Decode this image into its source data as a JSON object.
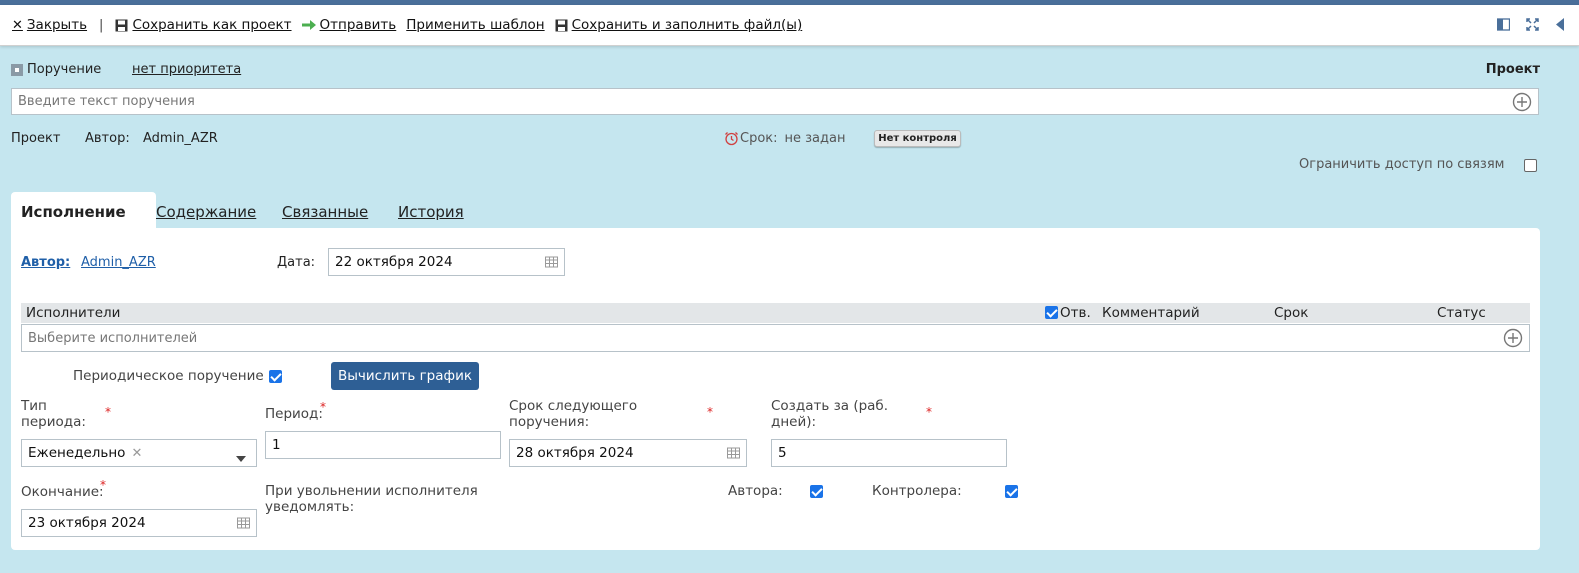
{
  "toolbar": {
    "close_label": "Закрыть",
    "separator": "|",
    "save_project_label": "Сохранить как проект",
    "send_label": "Отправить",
    "apply_template_label": "Применить шаблон",
    "save_fill_label": "Сохранить и заполнить файл(ы)"
  },
  "header": {
    "doc_type": "Поручение",
    "priority": "нет приоритета",
    "status": "Проект",
    "text_placeholder": "Введите текст поручения",
    "stage": "Проект",
    "author_label": "Автор:",
    "author_value": "Admin_AZR",
    "deadline_label": "Срок:",
    "deadline_value": "не задан",
    "control_badge": "Нет контроля",
    "restrict_access_label": "Ограничить доступ по связям",
    "restrict_access_checked": false
  },
  "tabs": [
    {
      "label": "Исполнение",
      "active": true
    },
    {
      "label": "Содержание",
      "active": false
    },
    {
      "label": "Связанные",
      "active": false
    },
    {
      "label": "История",
      "active": false
    }
  ],
  "execution": {
    "author_label": "Автор:",
    "author_value": "Admin_AZR",
    "date_label": "Дата:",
    "date_value": "22 октября 2024",
    "executors_grid": {
      "col_executors": "Исполнители",
      "col_resp": "Отв.",
      "col_resp_checked": true,
      "col_comment": "Комментарий",
      "col_deadline": "Срок",
      "col_status": "Статус",
      "placeholder": "Выберите исполнителей"
    },
    "periodic_label": "Периодическое поручение",
    "periodic_checked": true,
    "calc_button": "Вычислить график",
    "period_type_label": "Тип периода:",
    "period_type_value": "Еженедельно",
    "period_label": "Период:",
    "period_value": "1",
    "next_deadline_label": "Срок следующего поручения:",
    "next_deadline_value": "28 октября 2024",
    "create_before_label": "Создать за (раб. дней):",
    "create_before_value": "5",
    "end_label": "Окончание:",
    "end_value": "23 октября 2024",
    "notify_label": "При увольнении исполнителя уведомлять:",
    "notify_author_label": "Автора:",
    "notify_author_checked": true,
    "notify_controller_label": "Контролера:",
    "notify_controller_checked": true
  },
  "colors": {
    "background": "#c5e6ef",
    "accent": "#2e5f95",
    "link": "#1f5fa8",
    "required": "#d22222"
  }
}
